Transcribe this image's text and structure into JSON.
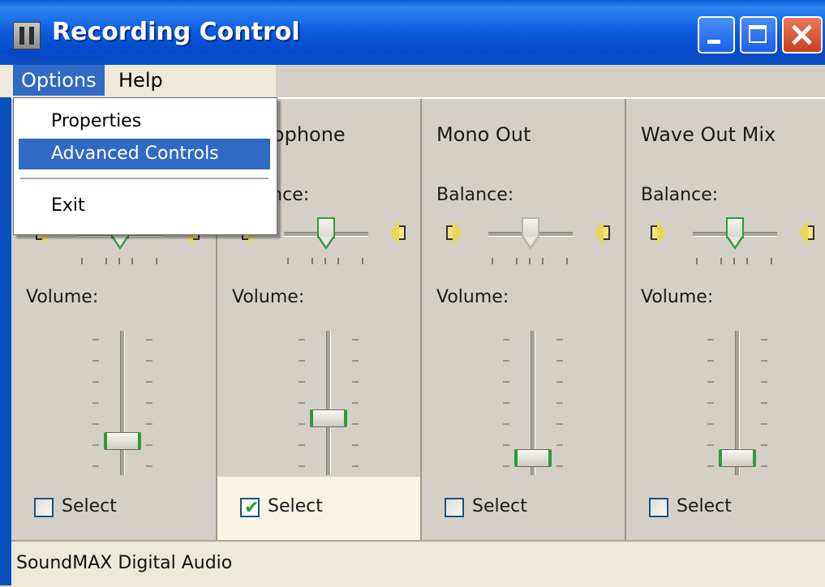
{
  "window": {
    "title": "Recording Control"
  },
  "menubar": {
    "options": "Options",
    "help": "Help"
  },
  "options_menu": {
    "items": [
      "Properties",
      "Advanced Controls",
      "Exit"
    ],
    "highlighted": "Advanced Controls"
  },
  "channels": [
    {
      "name": "",
      "balance_label": "Balance:",
      "volume_label": "Volume:",
      "select_label": "Select",
      "selected": false,
      "balance": 0.5,
      "volume": 0.15
    },
    {
      "name": "Microphone",
      "balance_label": "Balance:",
      "volume_label": "Volume:",
      "select_label": "Select",
      "selected": true,
      "balance": 0.5,
      "volume": 0.35
    },
    {
      "name": "Mono Out",
      "balance_label": "Balance:",
      "volume_label": "Volume:",
      "select_label": "Select",
      "selected": false,
      "balance": 0.5,
      "volume": 0.0
    },
    {
      "name": "Wave Out Mix",
      "balance_label": "Balance:",
      "volume_label": "Volume:",
      "select_label": "Select",
      "selected": false,
      "balance": 0.5,
      "volume": 0.0
    }
  ],
  "status": {
    "device": "SoundMAX Digital Audio"
  },
  "colors": {
    "title_bar": "#0a4ec0",
    "highlight": "#316ac5",
    "thumb_accent": "#2e9b3a",
    "checkmark": "#21a121"
  },
  "icons": [
    "app-mixer-icon",
    "minimize-icon",
    "maximize-icon",
    "close-icon",
    "speaker-left-icon",
    "speaker-right-icon",
    "checkmark-icon"
  ]
}
